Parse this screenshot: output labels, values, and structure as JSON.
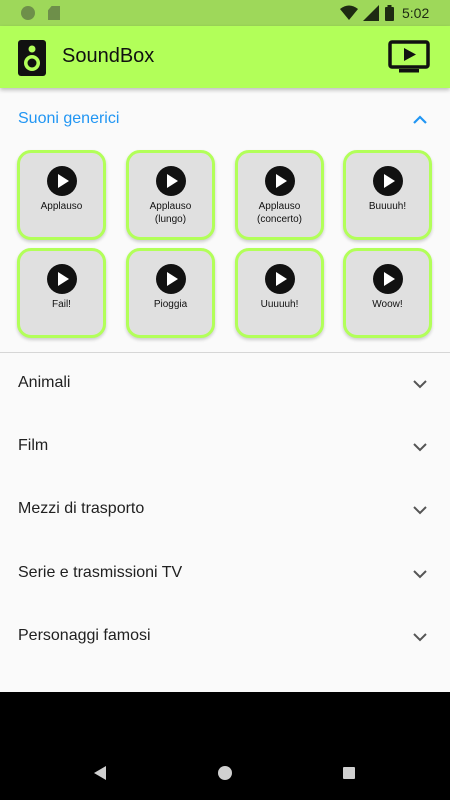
{
  "status_bar": {
    "time": "5:02"
  },
  "app_bar": {
    "title": "SoundBox",
    "logo_icon": "speaker-icon",
    "cast_icon": "cast-play-icon"
  },
  "expanded_section": {
    "label": "Suoni generici",
    "chevron_icon": "chevron-up-icon",
    "sounds": [
      "Applauso",
      "Applauso\n(lungo)",
      "Applauso\n(concerto)",
      "Buuuuh!",
      "Fail!",
      "Pioggia",
      "Uuuuuh!",
      "Woow!"
    ]
  },
  "categories": [
    "Animali",
    "Film",
    "Mezzi di trasporto",
    "Serie e trasmissioni TV",
    "Personaggi famosi"
  ],
  "colors": {
    "accent": "#2196f3",
    "app_bar": "#b2ff59",
    "status_bar": "#9ed85a"
  }
}
